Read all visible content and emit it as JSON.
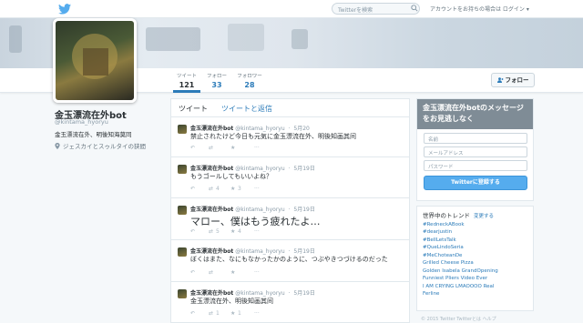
{
  "topbar": {
    "search_placeholder": "Twitterを検索",
    "login_text": "アカウントをお持ちの場合は ログイン ▾",
    "brand_color": "#55acee"
  },
  "profile": {
    "name": "金玉漂流在外bot",
    "handle": "@kintama_hyoryu",
    "bio": "金玉漂流在外、明後知海莫同",
    "location": "ジェスカイとスゥルタイの狭間",
    "follow_label": "フォロー",
    "stats": [
      {
        "label": "ツイート",
        "value": "121"
      },
      {
        "label": "フォロー",
        "value": "33"
      },
      {
        "label": "フォロワー",
        "value": "28"
      }
    ]
  },
  "timeline": {
    "tabs": [
      "ツイート",
      "ツイートと返信"
    ],
    "tweets": [
      {
        "name": "金玉漂流在外bot",
        "handle": "@kintama_hyoryu",
        "date": "5月20",
        "text": "禁止されたけど今日も元気に金玉漂流在外、明後知画其间",
        "rt": "",
        "fav": ""
      },
      {
        "name": "金玉漂流在外bot",
        "handle": "@kintama_hyoryu",
        "date": "5月19日",
        "text": "もうゴールしてもいいよね？",
        "rt": "4",
        "fav": "3"
      },
      {
        "name": "金玉漂流在外bot",
        "handle": "@kintama_hyoryu",
        "date": "5月19日",
        "text": "マロー、僕はもう疲れたよ…",
        "rt": "5",
        "fav": "4"
      },
      {
        "name": "金玉漂流在外bot",
        "handle": "@kintama_hyoryu",
        "date": "5月19日",
        "text": "ぼくはまた、なにもなかったかのように、つぶやきつづけるのだった",
        "rt": "",
        "fav": ""
      },
      {
        "name": "金玉漂流在外bot",
        "handle": "@kintama_hyoryu",
        "date": "5月19日",
        "text": "金玉漂流在外、明後知画其间",
        "rt": "1",
        "fav": "1"
      }
    ]
  },
  "signup": {
    "title": "金玉漂流在外botのメッセージをお見逃しなく",
    "name_placeholder": "名前",
    "email_placeholder": "メールアドレス",
    "password_placeholder": "パスワード",
    "button": "Twitterに登録する"
  },
  "trends": {
    "title": "世界中のトレンド",
    "change": "変更する",
    "items": [
      "#RedneckABook",
      "#dearjustin",
      "#BellLetsTalk",
      "#QueLindoSeria",
      "#MeChoteanDe",
      "Grilled Cheese Pizza",
      "Golden Isabela GrandOpening",
      "Funniest Pliers Video Ever",
      "I AM CRYING LMAOOOO Real",
      "Ferline"
    ]
  },
  "footer": {
    "text": "© 2015 Twitter  Twitterとは  ヘルプ"
  }
}
